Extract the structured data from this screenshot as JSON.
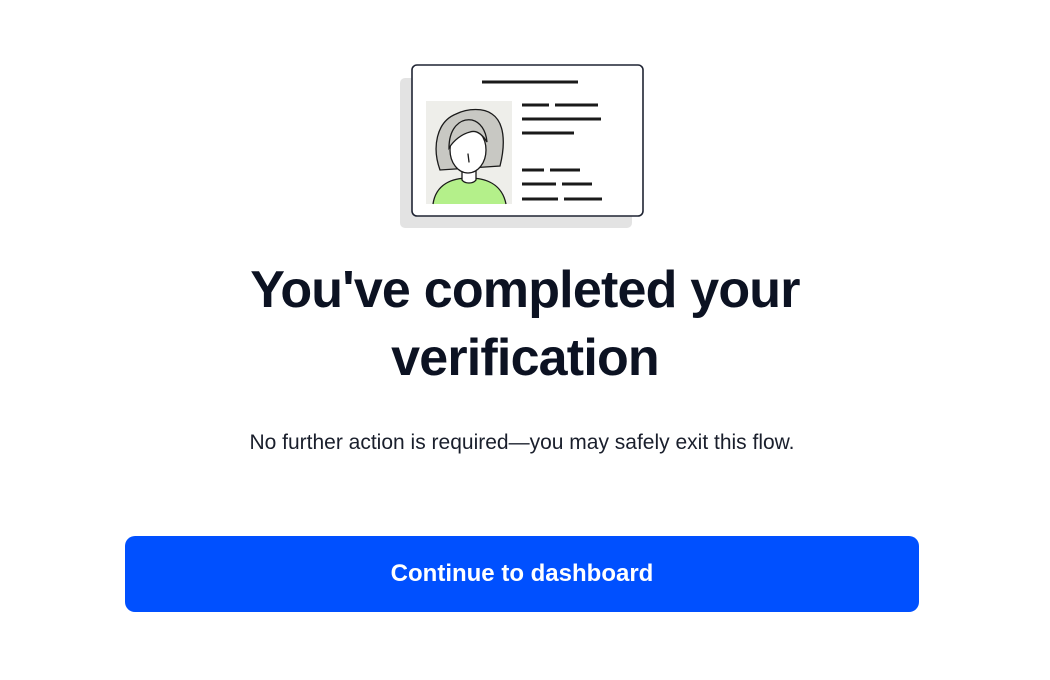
{
  "illustration": {
    "icon": "id-card-icon",
    "colors": {
      "card_shadow": "#e3e3e3",
      "card_border": "#1f2433",
      "photo_bg": "#eeeeea",
      "hair": "#c8c8c3",
      "shirt": "#b4f08a"
    }
  },
  "heading": {
    "title": "You've completed your verification"
  },
  "body": {
    "message": "No further action is required—you may safely exit this flow."
  },
  "actions": {
    "continue_label": "Continue to dashboard"
  },
  "theme": {
    "accent": "#0050ff",
    "title_color": "#0c1222",
    "text_color": "#1a1f2c",
    "background": "#ffffff"
  }
}
